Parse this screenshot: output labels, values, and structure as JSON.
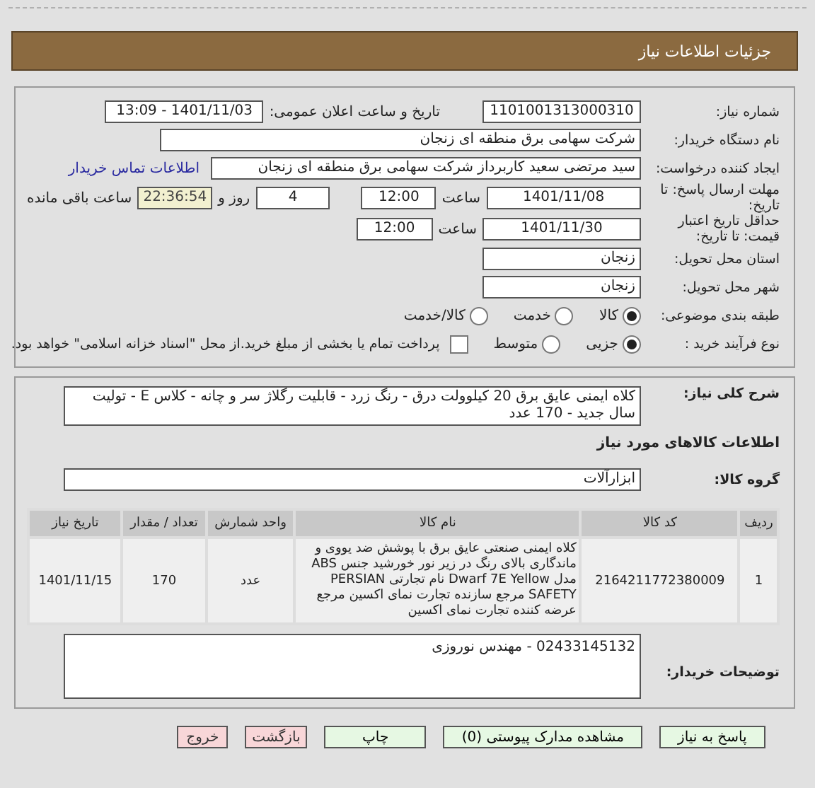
{
  "header": {
    "title": "جزئیات اطلاعات نیاز"
  },
  "need_number": {
    "label": "شماره نیاز:",
    "value": "1101001313000310"
  },
  "announce": {
    "label": "تاریخ و ساعت اعلان عمومی:",
    "value": "1401/11/03 - 13:09"
  },
  "buyer_org": {
    "label": "نام دستگاه خریدار:",
    "value": "شرکت سهامی برق منطقه ای زنجان"
  },
  "requester": {
    "label": "ایجاد کننده درخواست:",
    "value": "سید مرتضی  سعید کاربرداز شرکت سهامی برق منطقه ای زنجان",
    "link": "اطلاعات تماس خریدار"
  },
  "deadline": {
    "label": "مهلت ارسال پاسخ: تا تاریخ:",
    "date": "1401/11/08",
    "time_label": "ساعت",
    "time": "12:00",
    "days": "4",
    "days_label": "روز و",
    "remaining": "22:36:54",
    "remaining_label": "ساعت باقی مانده"
  },
  "validity": {
    "label": "حداقل تاریخ اعتبار قیمت: تا تاریخ:",
    "date": "1401/11/30",
    "time_label": "ساعت",
    "time": "12:00"
  },
  "province": {
    "label": "استان محل تحویل:",
    "value": "زنجان"
  },
  "city": {
    "label": "شهر محل تحویل:",
    "value": "زنجان"
  },
  "category": {
    "label": "طبقه بندی موضوعی:",
    "options": [
      {
        "label": "کالا",
        "selected": true
      },
      {
        "label": "خدمت",
        "selected": false
      },
      {
        "label": "کالا/خدمت",
        "selected": false
      }
    ]
  },
  "purchase_type": {
    "label": "نوع فرآیند خرید :",
    "options": [
      {
        "label": "جزیی",
        "selected": true
      },
      {
        "label": "متوسط",
        "selected": false
      }
    ],
    "payment": {
      "label": "پرداخت تمام یا بخشی از مبلغ خرید.از محل \"اسناد خزانه اسلامی\" خواهد بود.",
      "checked": false
    }
  },
  "description": {
    "label": "شرح کلی نیاز:",
    "value": "کلاه ایمنی عایق برق 20 کیلوولت درق - رنگ زرد - قابلیت رگلاژ سر و چانه - کلاس E - تولیت سال جدید - 170 عدد"
  },
  "goods_heading": "اطلاعات کالاهای مورد نیاز",
  "goods_group": {
    "label": "گروه کالا:",
    "value": "ابزارآلات"
  },
  "table": {
    "columns": [
      "ردیف",
      "کد کالا",
      "نام کالا",
      "واحد شمارش",
      "تعداد / مقدار",
      "تاریخ نیاز"
    ],
    "rows": [
      [
        "1",
        "2164211772380009",
        "کلاه ایمنی صنعتی عایق برق با پوشش ضد یووی و ماندگاری بالای رنگ در زیر نور خورشید جنس ABS مدل Dwarf 7E Yellow نام تجارتی PERSIAN SAFETY مرجع سازنده تجارت نمای اکسین مرجع عرضه کننده تجارت نمای اکسین",
        "عدد",
        "170",
        "1401/11/15"
      ]
    ]
  },
  "buyer_notes": {
    "label": "توضیحات خریدار:",
    "value": "02433145132 - مهندس نوروزی"
  },
  "buttons": [
    {
      "label": "پاسخ به نیاز",
      "kind": "action"
    },
    {
      "label": "مشاهده مدارک پیوستی (0)",
      "kind": "action"
    },
    {
      "label": "چاپ",
      "kind": "action"
    },
    {
      "label": "بازگشت",
      "kind": "exit"
    },
    {
      "label": "خروج",
      "kind": "exit"
    }
  ]
}
